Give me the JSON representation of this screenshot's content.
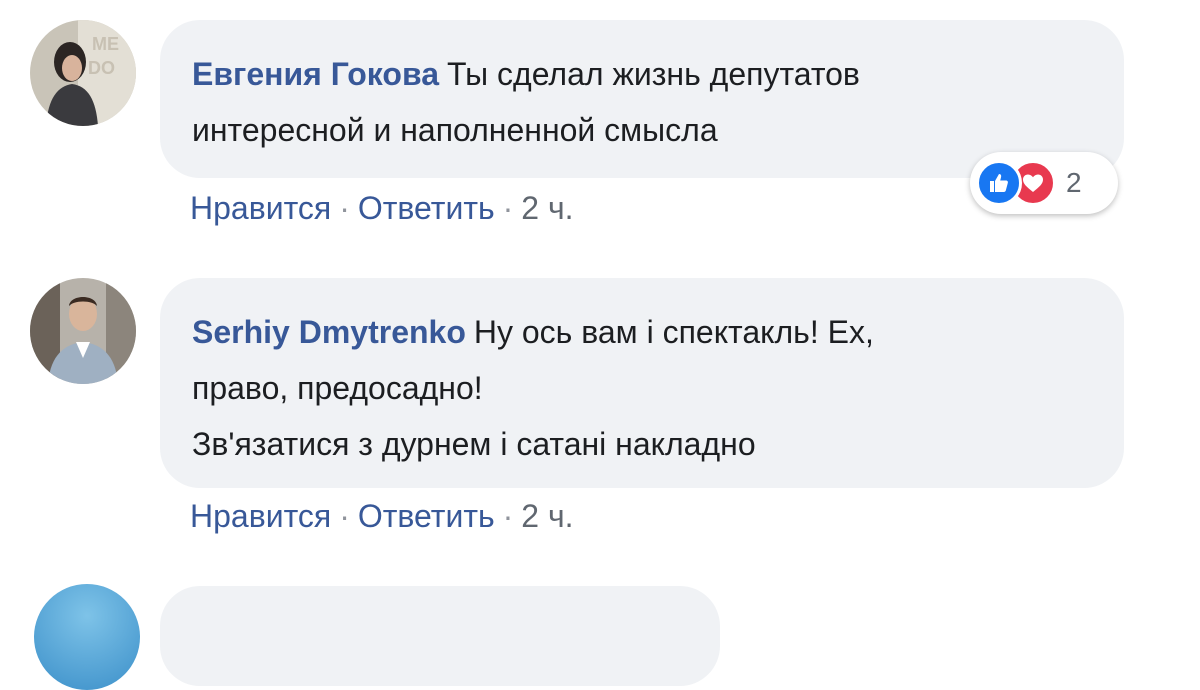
{
  "comments": [
    {
      "author": "Евгения Гокова",
      "text_lines": [
        "Ты сделал жизнь депутатов",
        "интересной и наполненной смысла"
      ],
      "like_label": "Нравится",
      "reply_label": "Ответить",
      "time": "2 ч.",
      "reaction_icons": [
        "like-icon",
        "love-icon"
      ],
      "reaction_count": "2",
      "colors": {
        "like": "#1877f2",
        "love": "#e8394f"
      }
    },
    {
      "author": "Serhiy Dmytrenko",
      "text_lines": [
        "Ну ось вам і спектакль! Ех,",
        "право, предосадно!",
        "Зв'язатися з дурнем і сатані накладно"
      ],
      "like_label": "Нравится",
      "reply_label": "Ответить",
      "time": "2 ч."
    }
  ],
  "separator": "·",
  "colors": {
    "author": "#385898",
    "bubble_bg": "#f0f2f5",
    "action_link": "#385898",
    "meta": "#606770"
  }
}
